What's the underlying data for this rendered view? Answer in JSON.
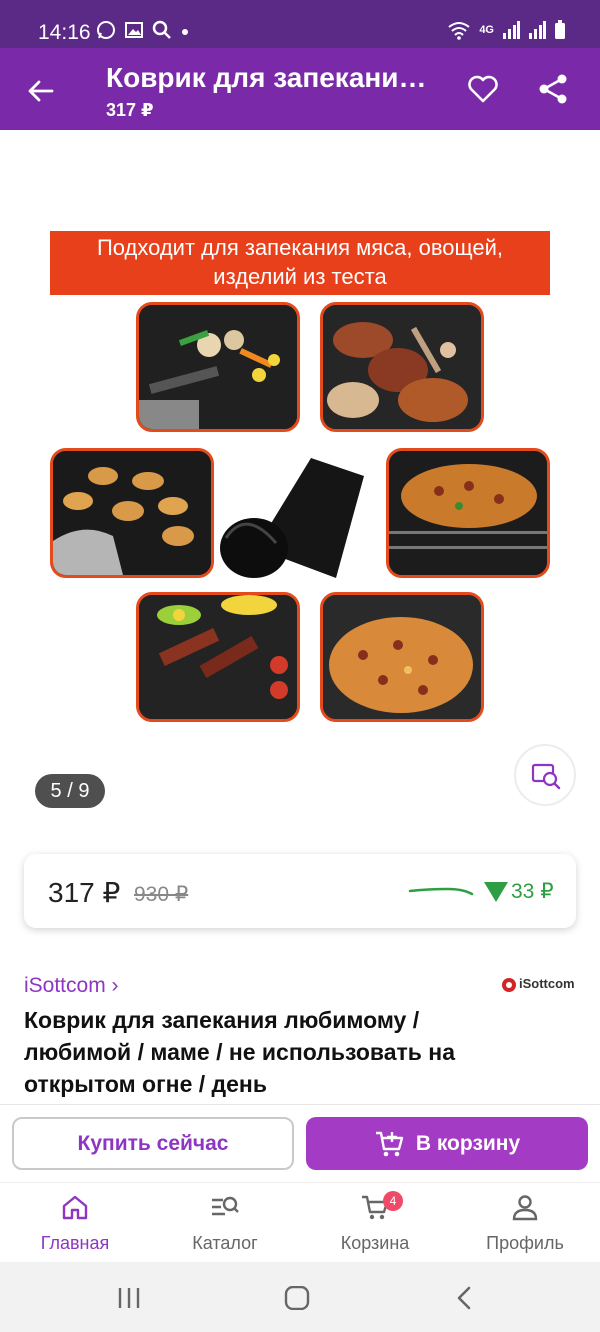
{
  "status_bar": {
    "time": "14:16",
    "network": "4G"
  },
  "appbar": {
    "title": "Коврик для запекания любимому",
    "price": "317 ₽"
  },
  "gallery": {
    "banner_line1": "Подходит для запекания мяса, овощей,",
    "banner_line2": "изделий из теста",
    "counter": "5 / 9"
  },
  "price_card": {
    "current": "317 ₽",
    "old": "930 ₽",
    "drop": "33 ₽"
  },
  "seller": {
    "name": "iSottcom ›",
    "logo_text": "iSottcom"
  },
  "product": {
    "title": "Коврик для запекания любимому / любимой / маме / не использовать на открытом огне / день"
  },
  "actions": {
    "buy_now": "Купить сейчас",
    "to_cart": "В корзину"
  },
  "tabs": [
    {
      "label": "Главная",
      "icon": "home-icon",
      "active": true
    },
    {
      "label": "Каталог",
      "icon": "catalog-search-icon"
    },
    {
      "label": "Корзина",
      "icon": "cart-icon",
      "badge": "4"
    },
    {
      "label": "Профиль",
      "icon": "profile-icon"
    }
  ],
  "colors": {
    "brand": "#7a2aa8",
    "accent": "#a43bc5",
    "price_drop": "#2e9e42",
    "banner": "#e8401a"
  }
}
